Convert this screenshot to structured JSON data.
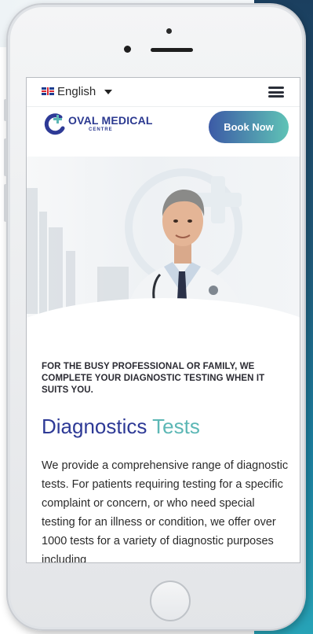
{
  "language": {
    "label": "English"
  },
  "logo": {
    "name": "OVAL MEDICAL",
    "subtitle": "CENTRE"
  },
  "header": {
    "book_label": "Book Now"
  },
  "content": {
    "tagline": "FOR THE BUSY PROFESSIONAL OR FAMILY, WE COMPLETE YOUR DIAGNOSTIC TESTING WHEN IT SUITS YOU.",
    "title_part1": "Diagnostics",
    "title_part2": "Tests",
    "body": "We provide a comprehensive range of diagnostic tests. For patients requiring testing for a specific complaint or concern, or who need special testing for an illness or condition, we offer over 1000 tests for a variety of diagnostic purposes including"
  },
  "colors": {
    "brand_blue": "#2e3a96",
    "brand_teal": "#5cb7b5",
    "button_gradient_start": "#3c5aa6",
    "button_gradient_end": "#5fc3b6"
  }
}
